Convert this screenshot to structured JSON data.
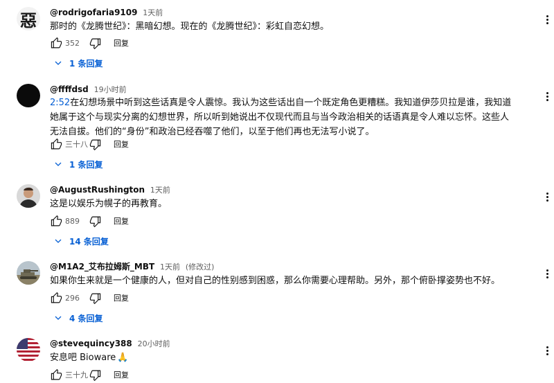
{
  "comments": [
    {
      "author": "@rodrigofaria9109",
      "time": "1天前",
      "text": "那时的《龙腾世纪》：黑暗幻想。现在的《龙腾世纪》：彩虹自恋幻想。",
      "likes": "352",
      "reply_label": "回复",
      "replies_label": "1 条回复",
      "avatar_char": "惡"
    },
    {
      "author": "@ffffdsd",
      "time": "19小时前",
      "timestamp_link": "2:52",
      "text": "在幻想场景中听到这些话真是令人震惊。我认为这些话出自一个既定角色更糟糕。我知道伊莎贝拉是谁，我知道她属于这个与现实分离的幻想世界，所以听到她说出不仅现代而且与当今政治相关的话语真是令人难以忘怀。这些人无法自拔。他们的“身份”和政治已经吞噬了他们，以至于他们再也无法写小说了。",
      "likes": "三十八",
      "reply_label": "回复",
      "replies_label": "1 条回复"
    },
    {
      "author": "@AugustRushington",
      "time": "1天前",
      "text": "这是以娱乐为幌子的再教育。",
      "likes": "889",
      "reply_label": "回复",
      "replies_label": "14 条回复"
    },
    {
      "author": "@M1A2_艾布拉姆斯_MBT",
      "time": "1天前",
      "edited": "(修改过)",
      "text": "如果你生来就是一个健康的人，但对自己的性别感到困惑，那么你需要心理帮助。另外，那个俯卧撑姿势也不好。",
      "likes": "296",
      "reply_label": "回复",
      "replies_label": "4 条回复"
    },
    {
      "author": "@stevequincy388",
      "time": "20小时前",
      "text": "安息吧 Bioware",
      "emoji": "🙏",
      "likes": "三十九",
      "reply_label": "回复"
    }
  ]
}
